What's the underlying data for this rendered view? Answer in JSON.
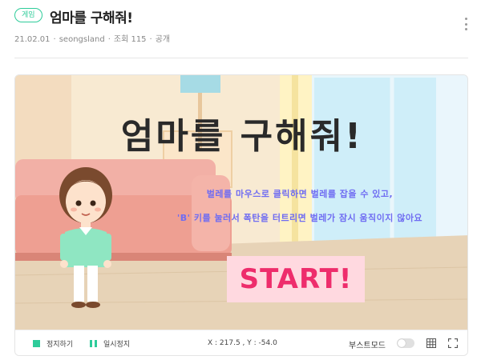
{
  "post": {
    "badge": "게임",
    "title": "엄마를 구해줘!",
    "date": "21.02.01",
    "author": "seongsland",
    "views_label": "조회 115",
    "visibility": "공개",
    "sep": "·"
  },
  "game": {
    "title": "엄마를 구해줘!",
    "instruction_1": "벌레를 마우스로 클릭하면 벌레를 잡을 수 있고,",
    "instruction_2": "'B' 키를 눌러서 폭탄을 터트리면 벌레가 잠시 움직이지 않아요",
    "start_label": "START!"
  },
  "controls": {
    "stop_label": "정지하기",
    "pause_label": "일시정지",
    "coords": "X : 217.5 , Y : -54.0",
    "boost_label": "부스트모드"
  },
  "colors": {
    "accent": "#2ecc9a",
    "instruction": "#6f6cf2",
    "start_text": "#ee2d6c",
    "start_bg": "#ffd9e0"
  },
  "icons": {
    "more": "more-vertical-icon",
    "stop": "stop-icon",
    "pause": "pause-icon",
    "grid": "grid-icon",
    "fullscreen": "fullscreen-icon"
  }
}
